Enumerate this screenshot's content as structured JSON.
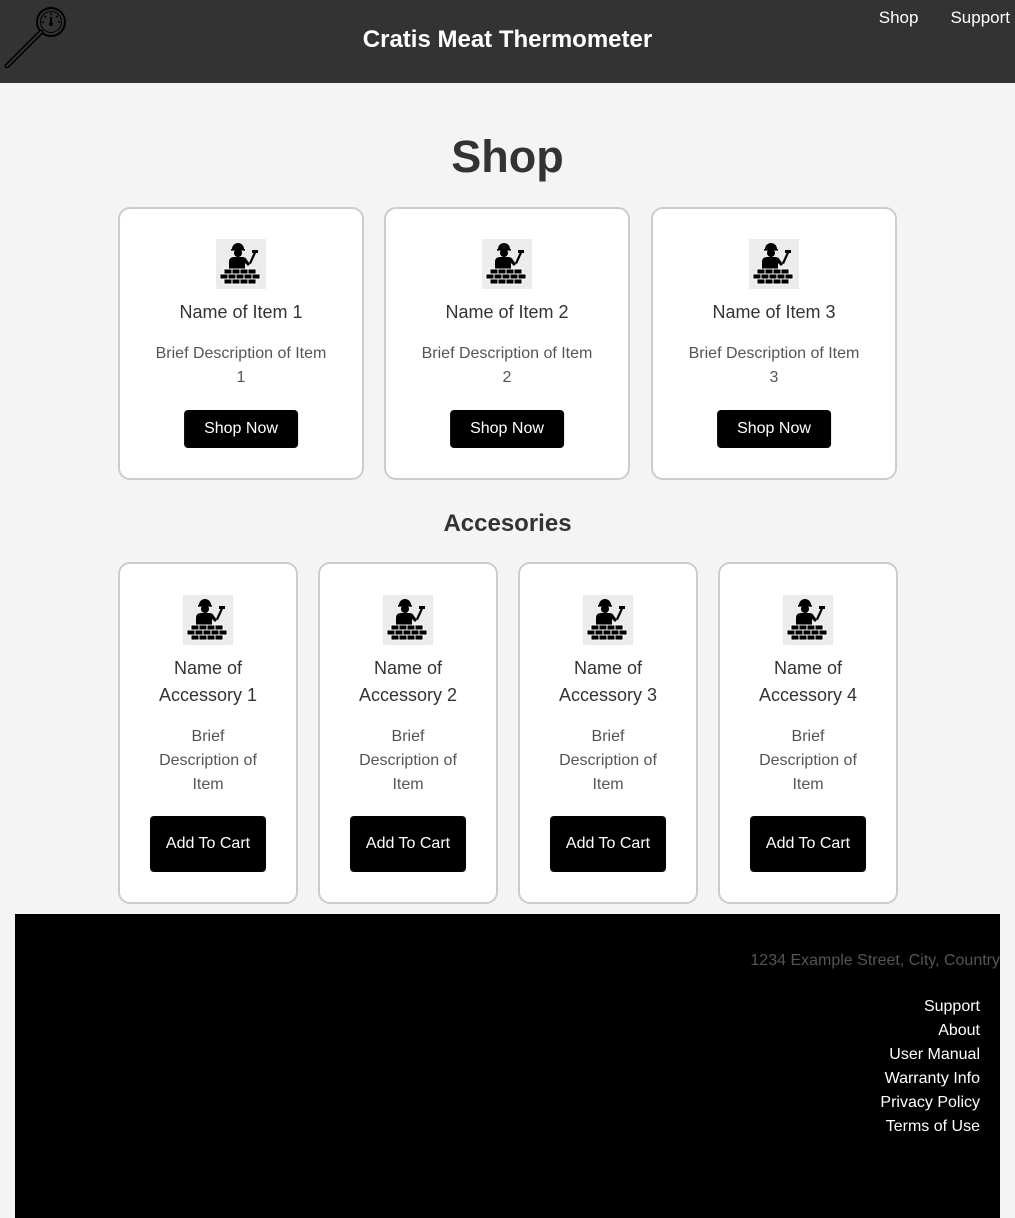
{
  "header": {
    "title": "Cratis Meat Thermometer",
    "logo_icon": "meat-thermometer-icon",
    "nav": [
      "Shop",
      "Support"
    ]
  },
  "main": {
    "title": "Shop",
    "products": [
      {
        "name": "Name of Item 1",
        "description": "Brief Description of Item 1",
        "button": "Shop Now",
        "image_icon": "construction-worker-icon"
      },
      {
        "name": "Name of Item 2",
        "description": "Brief Description of Item 2",
        "button": "Shop Now",
        "image_icon": "construction-worker-icon"
      },
      {
        "name": "Name of Item 3",
        "description": "Brief Description of Item 3",
        "button": "Shop Now",
        "image_icon": "construction-worker-icon"
      }
    ],
    "accessories_title": "Accesories",
    "accessories": [
      {
        "name": "Name of Accessory 1",
        "description": "Brief Description of Item",
        "button": "Add To Cart",
        "image_icon": "construction-worker-icon"
      },
      {
        "name": "Name of Accessory 2",
        "description": "Brief Description of Item",
        "button": "Add To Cart",
        "image_icon": "construction-worker-icon"
      },
      {
        "name": "Name of Accessory 3",
        "description": "Brief Description of Item",
        "button": "Add To Cart",
        "image_icon": "construction-worker-icon"
      },
      {
        "name": "Name of Accessory 4",
        "description": "Brief Description of Item",
        "button": "Add To Cart",
        "image_icon": "construction-worker-icon"
      }
    ]
  },
  "footer": {
    "address": "1234 Example Street, City, Country",
    "links": [
      "Support",
      "About",
      "User Manual",
      "Warranty Info",
      "Privacy Policy",
      "Terms of Use"
    ]
  },
  "colors": {
    "header_bg": "#333333",
    "page_bg": "#f4f4f4",
    "button_bg": "#000000",
    "footer_bg": "#000000"
  }
}
